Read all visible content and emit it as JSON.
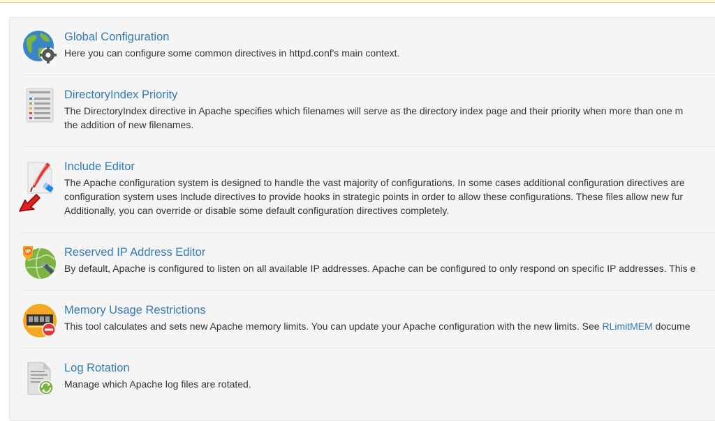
{
  "items": [
    {
      "title": "Global Configuration",
      "icon": "globe-gear-icon",
      "desc": [
        "Here you can configure some common directives in httpd.conf's main context."
      ]
    },
    {
      "title": "DirectoryIndex Priority",
      "icon": "list-document-icon",
      "desc": [
        "The DirectoryIndex directive in Apache specifies which filenames will serve as the directory index page and their priority when more than one m",
        "the addition of new filenames."
      ]
    },
    {
      "title": "Include Editor",
      "icon": "quill-document-icon",
      "desc": [
        "The Apache configuration system is designed to handle the vast majority of configurations. In some cases additional configuration directives are",
        "configuration system uses Include directives to provide hooks in strategic points in order to allow these configurations. These files allow new fur",
        "Additionally, you can override or disable some default configuration directives completely."
      ]
    },
    {
      "title": "Reserved IP Address Editor",
      "icon": "ip-globe-icon",
      "desc": [
        "By default, Apache is configured to listen on all available IP addresses. Apache can be configured to only respond on specific IP addresses. This e"
      ]
    },
    {
      "title": "Memory Usage Restrictions",
      "icon": "memory-chip-icon",
      "desc_before_link": "This tool calculates and sets new Apache memory limits. You can update your Apache configuration with the new limits. See ",
      "link": "RLimitMEM",
      "desc_after_link": " docume"
    },
    {
      "title": "Log Rotation",
      "icon": "log-rotate-icon",
      "desc": [
        "Manage which Apache log files are rotated."
      ]
    }
  ],
  "colors": {
    "link": "#337ab7",
    "text": "#333333",
    "arrow": "#e02020"
  }
}
